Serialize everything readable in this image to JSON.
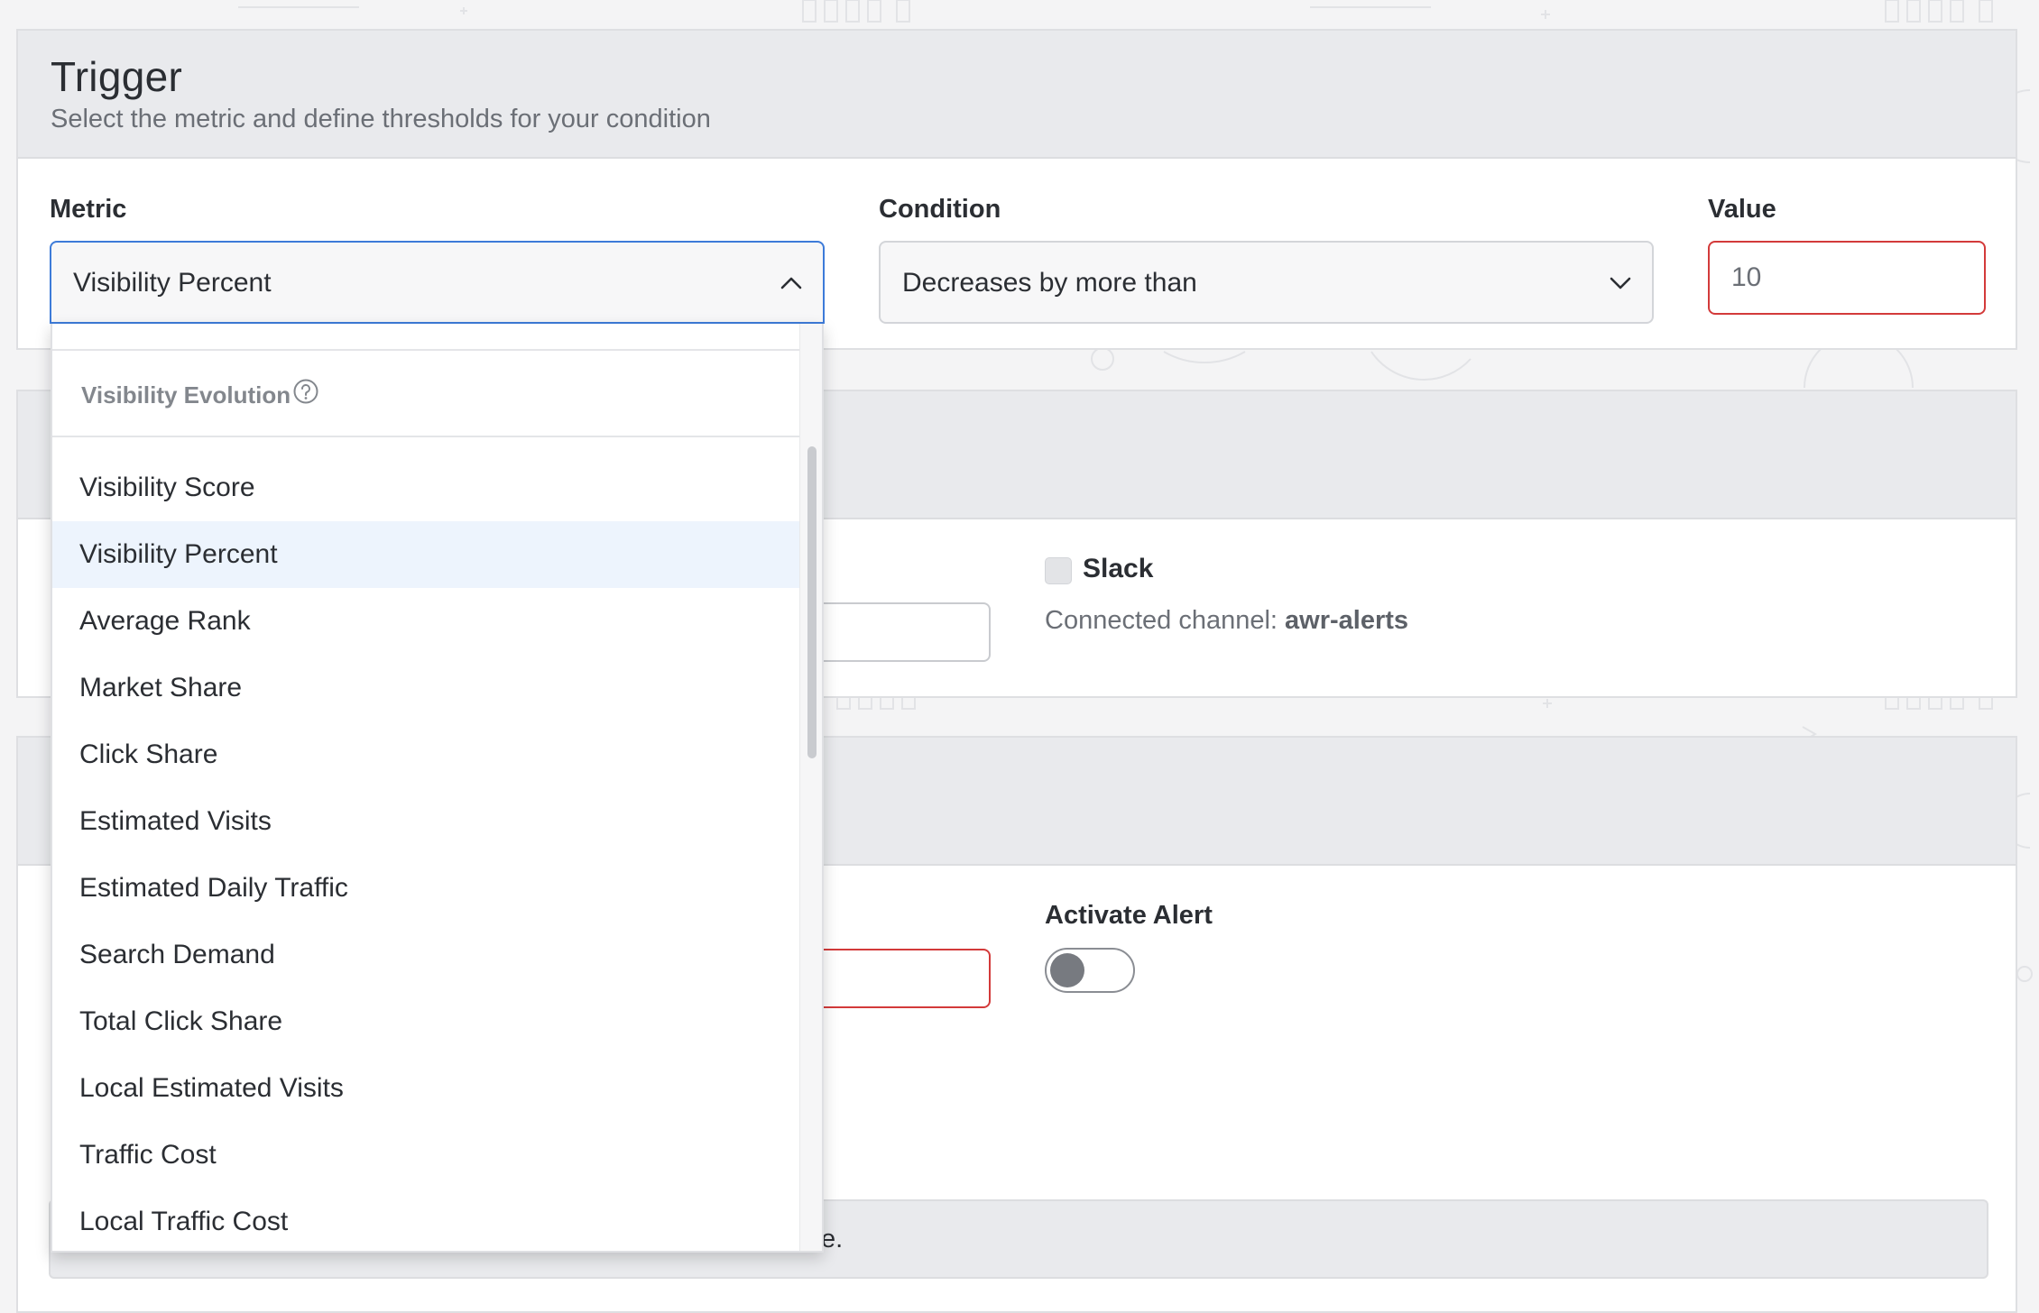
{
  "trigger": {
    "title": "Trigger",
    "subtitle": "Select the metric and define thresholds for your condition",
    "metric_label": "Metric",
    "metric_value": "Visibility Percent",
    "condition_label": "Condition",
    "condition_value": "Decreases by more than",
    "value_label": "Value",
    "value_input": "10"
  },
  "notifications": {
    "slack_label": "Slack",
    "connected_prefix": "Connected channel:",
    "connected_channel": "awr-alerts"
  },
  "activation": {
    "activate_label": "Activate Alert",
    "toggle_on": false,
    "info_tail": "e."
  },
  "dropdown": {
    "group_label": "Visibility Evolution",
    "group_icon": "help-circle-icon",
    "items": [
      "Visibility Score",
      "Visibility Percent",
      "Average Rank",
      "Market Share",
      "Click Share",
      "Estimated Visits",
      "Estimated Daily Traffic",
      "Search Demand",
      "Total Click Share",
      "Local Estimated Visits",
      "Traffic Cost",
      "Local Traffic Cost"
    ],
    "selected": "Visibility Percent"
  },
  "colors": {
    "focus_border": "#3d7bd9",
    "error_border": "#d33a3a",
    "selected_item_bg": "#edf4fd"
  }
}
